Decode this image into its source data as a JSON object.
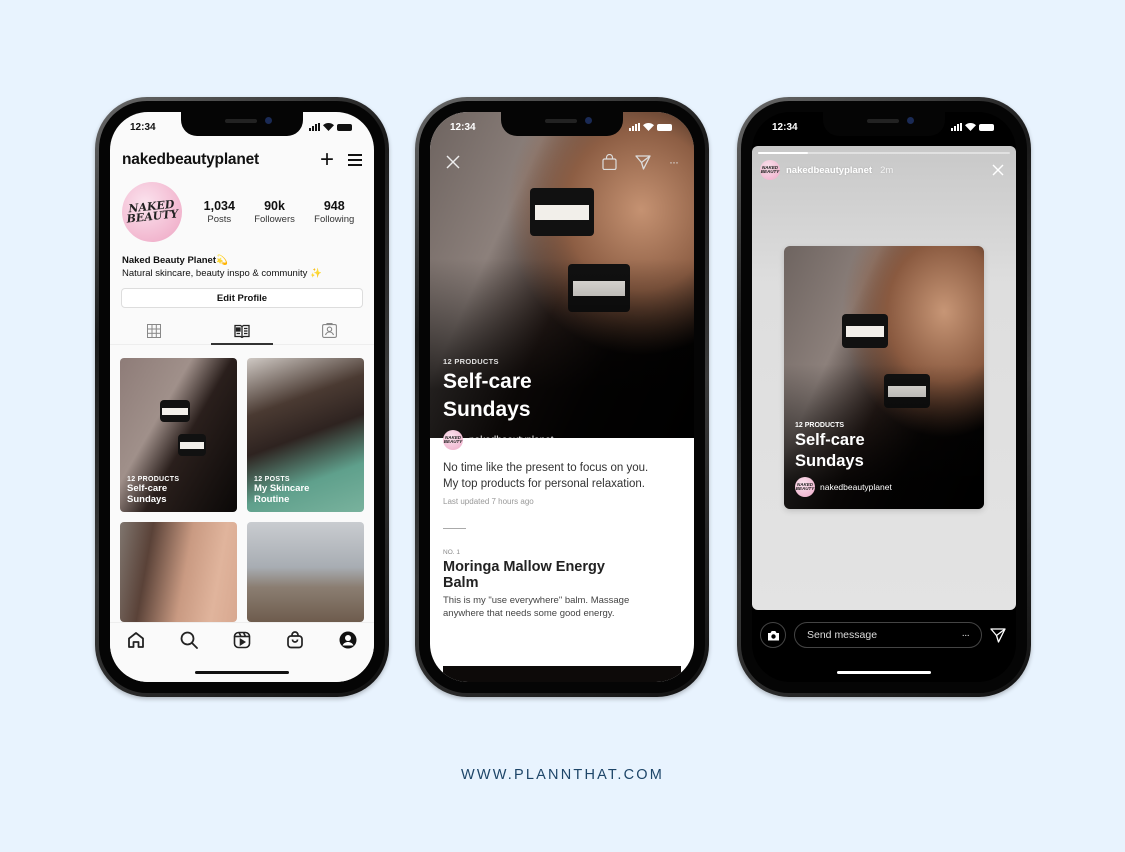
{
  "footer": {
    "url": "WWW.PLANNTHAT.COM"
  },
  "colors": {
    "background": "#E8F3FE",
    "footer_text": "#1d4568",
    "avatar_pink": "#f2b7cf"
  },
  "phone_profile": {
    "status_time": "12:34",
    "username": "nakedbeautyplanet",
    "icons": {
      "add": "plus-icon",
      "menu": "hamburger-menu-icon"
    },
    "avatar_text": [
      "NAKED",
      "BEAUTY"
    ],
    "stats": [
      {
        "value": "1,034",
        "label": "Posts"
      },
      {
        "value": "90k",
        "label": "Followers"
      },
      {
        "value": "948",
        "label": "Following"
      }
    ],
    "bio_name": "Naked Beauty Planet",
    "bio_name_emoji": "💫",
    "bio_text": "Natural skincare, beauty inspo & community",
    "bio_emoji": "✨",
    "edit_profile": "Edit Profile",
    "tabs": [
      {
        "icon": "grid-icon",
        "active": false
      },
      {
        "icon": "guides-icon",
        "active": true
      },
      {
        "icon": "tagged-icon",
        "active": false
      }
    ],
    "grid": [
      {
        "kicker": "12 PRODUCTS",
        "title_1": "Self-care",
        "title_2": "Sundays"
      },
      {
        "kicker": "12 POSTS",
        "title_1": "My Skincare",
        "title_2": "Routine"
      },
      {
        "kicker": "",
        "title_1": "",
        "title_2": ""
      },
      {
        "kicker": "",
        "title_1": "",
        "title_2": ""
      }
    ],
    "bottom_nav": [
      "home-icon",
      "search-icon",
      "reels-icon",
      "shop-icon",
      "profile-icon"
    ]
  },
  "phone_guide": {
    "status_time": "12:34",
    "kicker": "12 PRODUCTS",
    "title_1": "Self-care",
    "title_2": "Sundays",
    "author": "nakedbeautyplanet",
    "avatar_text": "NAKED BEAUTY",
    "description_1": "No time like the present to focus on you.",
    "description_2": "My top products for personal relaxation.",
    "updated": "Last updated 7 hours ago",
    "item_number": "NO. 1",
    "product_title_1": "Moringa Mallow Energy",
    "product_title_2": "Balm",
    "product_desc_1": "This is my \"use everywhere\" balm. Massage",
    "product_desc_2": "anywhere that needs some good energy.",
    "more_label": "···"
  },
  "phone_story": {
    "status_time": "12:34",
    "progress": 0.2,
    "username": "nakedbeautyplanet",
    "time_ago": "2m",
    "avatar_text": "NAKED BEAUTY",
    "card_kicker": "12 PRODUCTS",
    "card_title_1": "Self-care",
    "card_title_2": "Sundays",
    "card_author": "nakedbeautyplanet",
    "message_placeholder": "Send message",
    "more_label": "···"
  }
}
